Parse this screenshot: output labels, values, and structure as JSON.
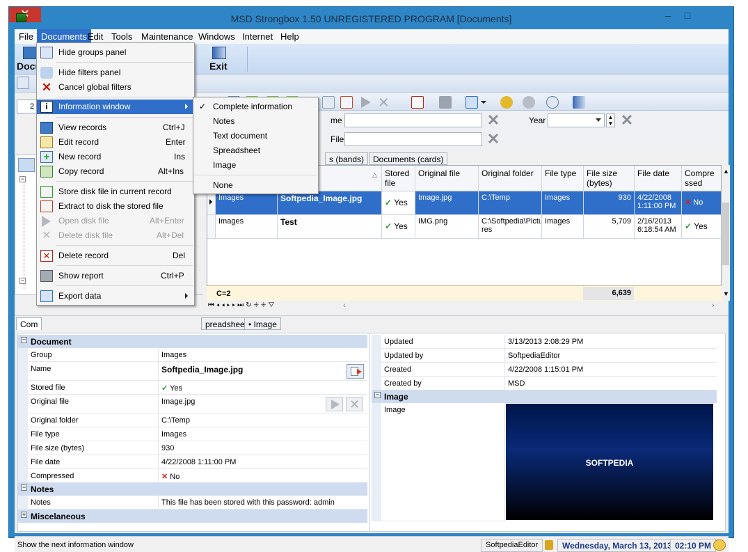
{
  "window": {
    "title": "MSD Strongbox 1.50 UNREGISTERED PROGRAM [Documents]",
    "minimize": "–",
    "maximize": "□",
    "close": "✕"
  },
  "menubar": [
    "File",
    "Documents",
    "Edit",
    "Tools",
    "Maintenance",
    "Windows",
    "Internet",
    "Help"
  ],
  "ribbon": {
    "documents_label": "Docu",
    "exit_label": "Exit"
  },
  "toolbar_left": {
    "field_value": "2"
  },
  "filters": {
    "name_label": "me",
    "file_label": "File",
    "year_label": "Year"
  },
  "top_tabs": [
    "s (bands)",
    "Documents (cards)"
  ],
  "grid": {
    "columns": [
      "",
      "",
      "Stored file",
      "Original file",
      "Original folder",
      "File type",
      "File size (bytes)",
      "File date",
      "Compre ssed"
    ],
    "rows": [
      {
        "group": "Images",
        "name": "Softpedia_Image.jpg",
        "stored": "Yes",
        "original": "Image.jpg",
        "folder": "C:\\Temp",
        "type": "Images",
        "size": "930",
        "date1": "4/22/2008",
        "date2": "1:11:00 PM",
        "compressed": "No",
        "selected": true
      },
      {
        "group": "Images",
        "name": "Test",
        "stored": "Yes",
        "original": "IMG.png",
        "folder1": "C:\\Softpedia\\Pictu",
        "folder2": "res",
        "type": "Images",
        "size": "5,709",
        "date1": "2/16/2013",
        "date2": "6:18:54 AM",
        "compressed": "Yes",
        "selected": false
      }
    ],
    "footer_count": "C=2",
    "footer_total": "6,639"
  },
  "bottom_tabs": [
    "Com",
    "preadsheet",
    "Image"
  ],
  "props_left": {
    "section_document": "Document",
    "rows": [
      {
        "k": "Group",
        "v": "Images"
      },
      {
        "k": "Name",
        "v": "Softpedia_Image.jpg"
      },
      {
        "k": "Stored file",
        "v": "Yes"
      },
      {
        "k": "Original file",
        "v": "Image.jpg"
      },
      {
        "k": "Original folder",
        "v": "C:\\Temp"
      },
      {
        "k": "File type",
        "v": "Images"
      },
      {
        "k": "File size (bytes)",
        "v": "930"
      },
      {
        "k": "File date",
        "v": "4/22/2008 1:11:00 PM"
      },
      {
        "k": "Compressed",
        "v": "No"
      }
    ],
    "section_notes": "Notes",
    "notes_key": "Notes",
    "notes_value": "This file has been stored with this password: admin",
    "section_misc": "Miscelaneous"
  },
  "props_right": {
    "rows": [
      {
        "k": "Updated",
        "v": "3/13/2013 2:08:29 PM"
      },
      {
        "k": "Updated by",
        "v": "SoftpediaEditor"
      },
      {
        "k": "Created",
        "v": "4/22/2008 1:15:01 PM"
      },
      {
        "k": "Created by",
        "v": "MSD"
      }
    ],
    "section_image": "Image",
    "image_key": "Image",
    "image_text": "SOFTPEDIA"
  },
  "statusbar": {
    "hint": "Show the next information window",
    "user": "SoftpediaEditor",
    "date": "Wednesday, March 13, 2013",
    "time": "02:10 PM"
  },
  "documents_menu": [
    {
      "label": "Hide groups panel",
      "shortcut": ""
    },
    {
      "label": "Hide filters panel",
      "shortcut": ""
    },
    {
      "label": "Cancel global filters",
      "shortcut": ""
    },
    {
      "label": "Information window",
      "shortcut": ""
    },
    {
      "label": "View records",
      "shortcut": "Ctrl+J"
    },
    {
      "label": "Edit record",
      "shortcut": "Enter"
    },
    {
      "label": "New record",
      "shortcut": "Ins"
    },
    {
      "label": "Copy record",
      "shortcut": "Alt+Ins"
    },
    {
      "label": "Store disk file in current record",
      "shortcut": ""
    },
    {
      "label": "Extract to disk the stored file",
      "shortcut": ""
    },
    {
      "label": "Open disk file",
      "shortcut": "Alt+Enter"
    },
    {
      "label": "Delete disk file",
      "shortcut": "Alt+Del"
    },
    {
      "label": "Delete record",
      "shortcut": "Del"
    },
    {
      "label": "Show report",
      "shortcut": "Ctrl+P"
    },
    {
      "label": "Export data",
      "shortcut": ""
    }
  ],
  "info_submenu": [
    "Complete information",
    "Notes",
    "Text document",
    "Spreadsheet",
    "Image",
    "None"
  ]
}
